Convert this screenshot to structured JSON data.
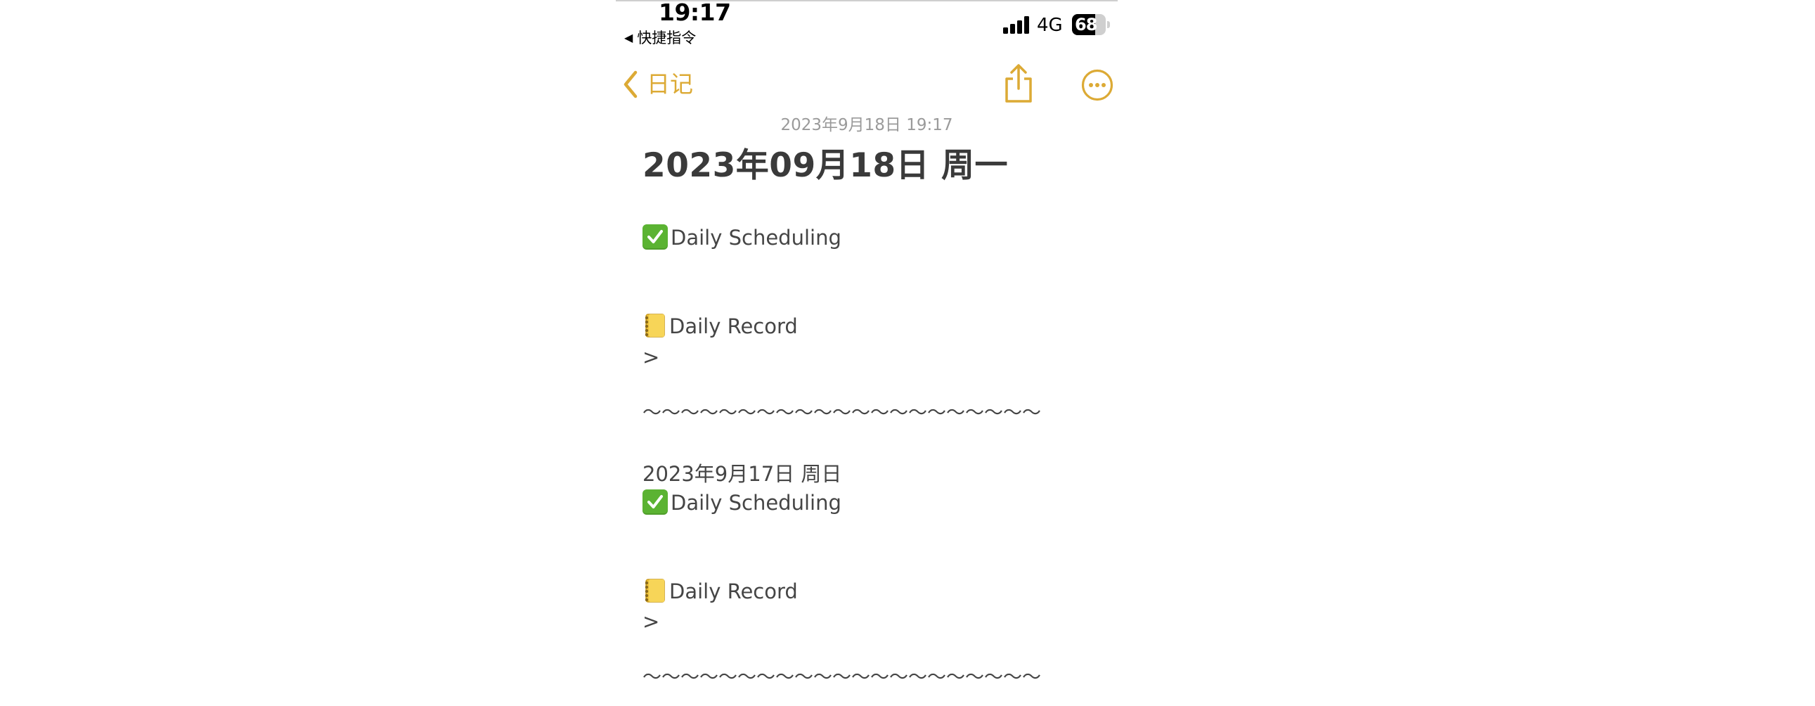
{
  "status_bar": {
    "time": "19:17",
    "back_app": "快捷指令",
    "back_arrow": "◀",
    "network": "4G",
    "battery_percent": "68",
    "battery_level": 0.68
  },
  "nav": {
    "back_label": "日记",
    "accent_color": "#dcaa35",
    "icons": [
      "chevron-left-icon",
      "share-icon",
      "more-icon"
    ]
  },
  "note": {
    "timestamp": "2023年9月18日 19:17",
    "title": "2023年09月18日 周一",
    "entries": [
      {
        "scheduling": "Daily Scheduling",
        "record": "Daily Record",
        "quote": ">",
        "separator": "～～～～～～～～～～～～～～～～～～～～～"
      },
      {
        "date": "2023年9月17日 周日",
        "scheduling": "Daily Scheduling",
        "record": "Daily Record",
        "quote": ">",
        "separator": "～～～～～～～～～～～～～～～～～～～～～"
      }
    ]
  }
}
